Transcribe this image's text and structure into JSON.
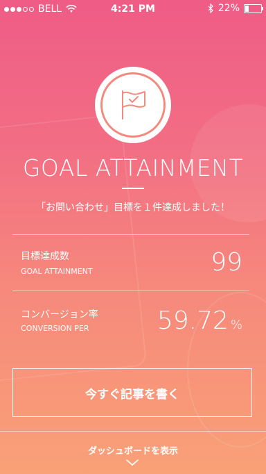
{
  "status_bar": {
    "carrier": "BELL",
    "time": "4:21 PM",
    "battery": "22%",
    "battery_level": 0.22,
    "signal_dots": 5,
    "signal_filled": 3
  },
  "badge": {
    "icon": "flag-icon"
  },
  "heading": {
    "title": "GOAL ATTAINMENT",
    "message": "「お問い合わせ」目標を１件達成しました！"
  },
  "stats": {
    "goal": {
      "label_jp": "目標達成数",
      "label_en": "GOAL ATTAINMENT",
      "value": "99"
    },
    "conversion": {
      "label_jp": "コンバージョン率",
      "label_en": "CONVERSION PER",
      "value": "59.72",
      "unit": "%"
    }
  },
  "actions": {
    "write_label": "今すぐ記事を書く",
    "dashboard_label": "ダッシュボードを表示"
  },
  "colors": {
    "gradient_top": "#ef5c86",
    "gradient_bottom": "#f9a177",
    "accent": "#f48a7d"
  }
}
